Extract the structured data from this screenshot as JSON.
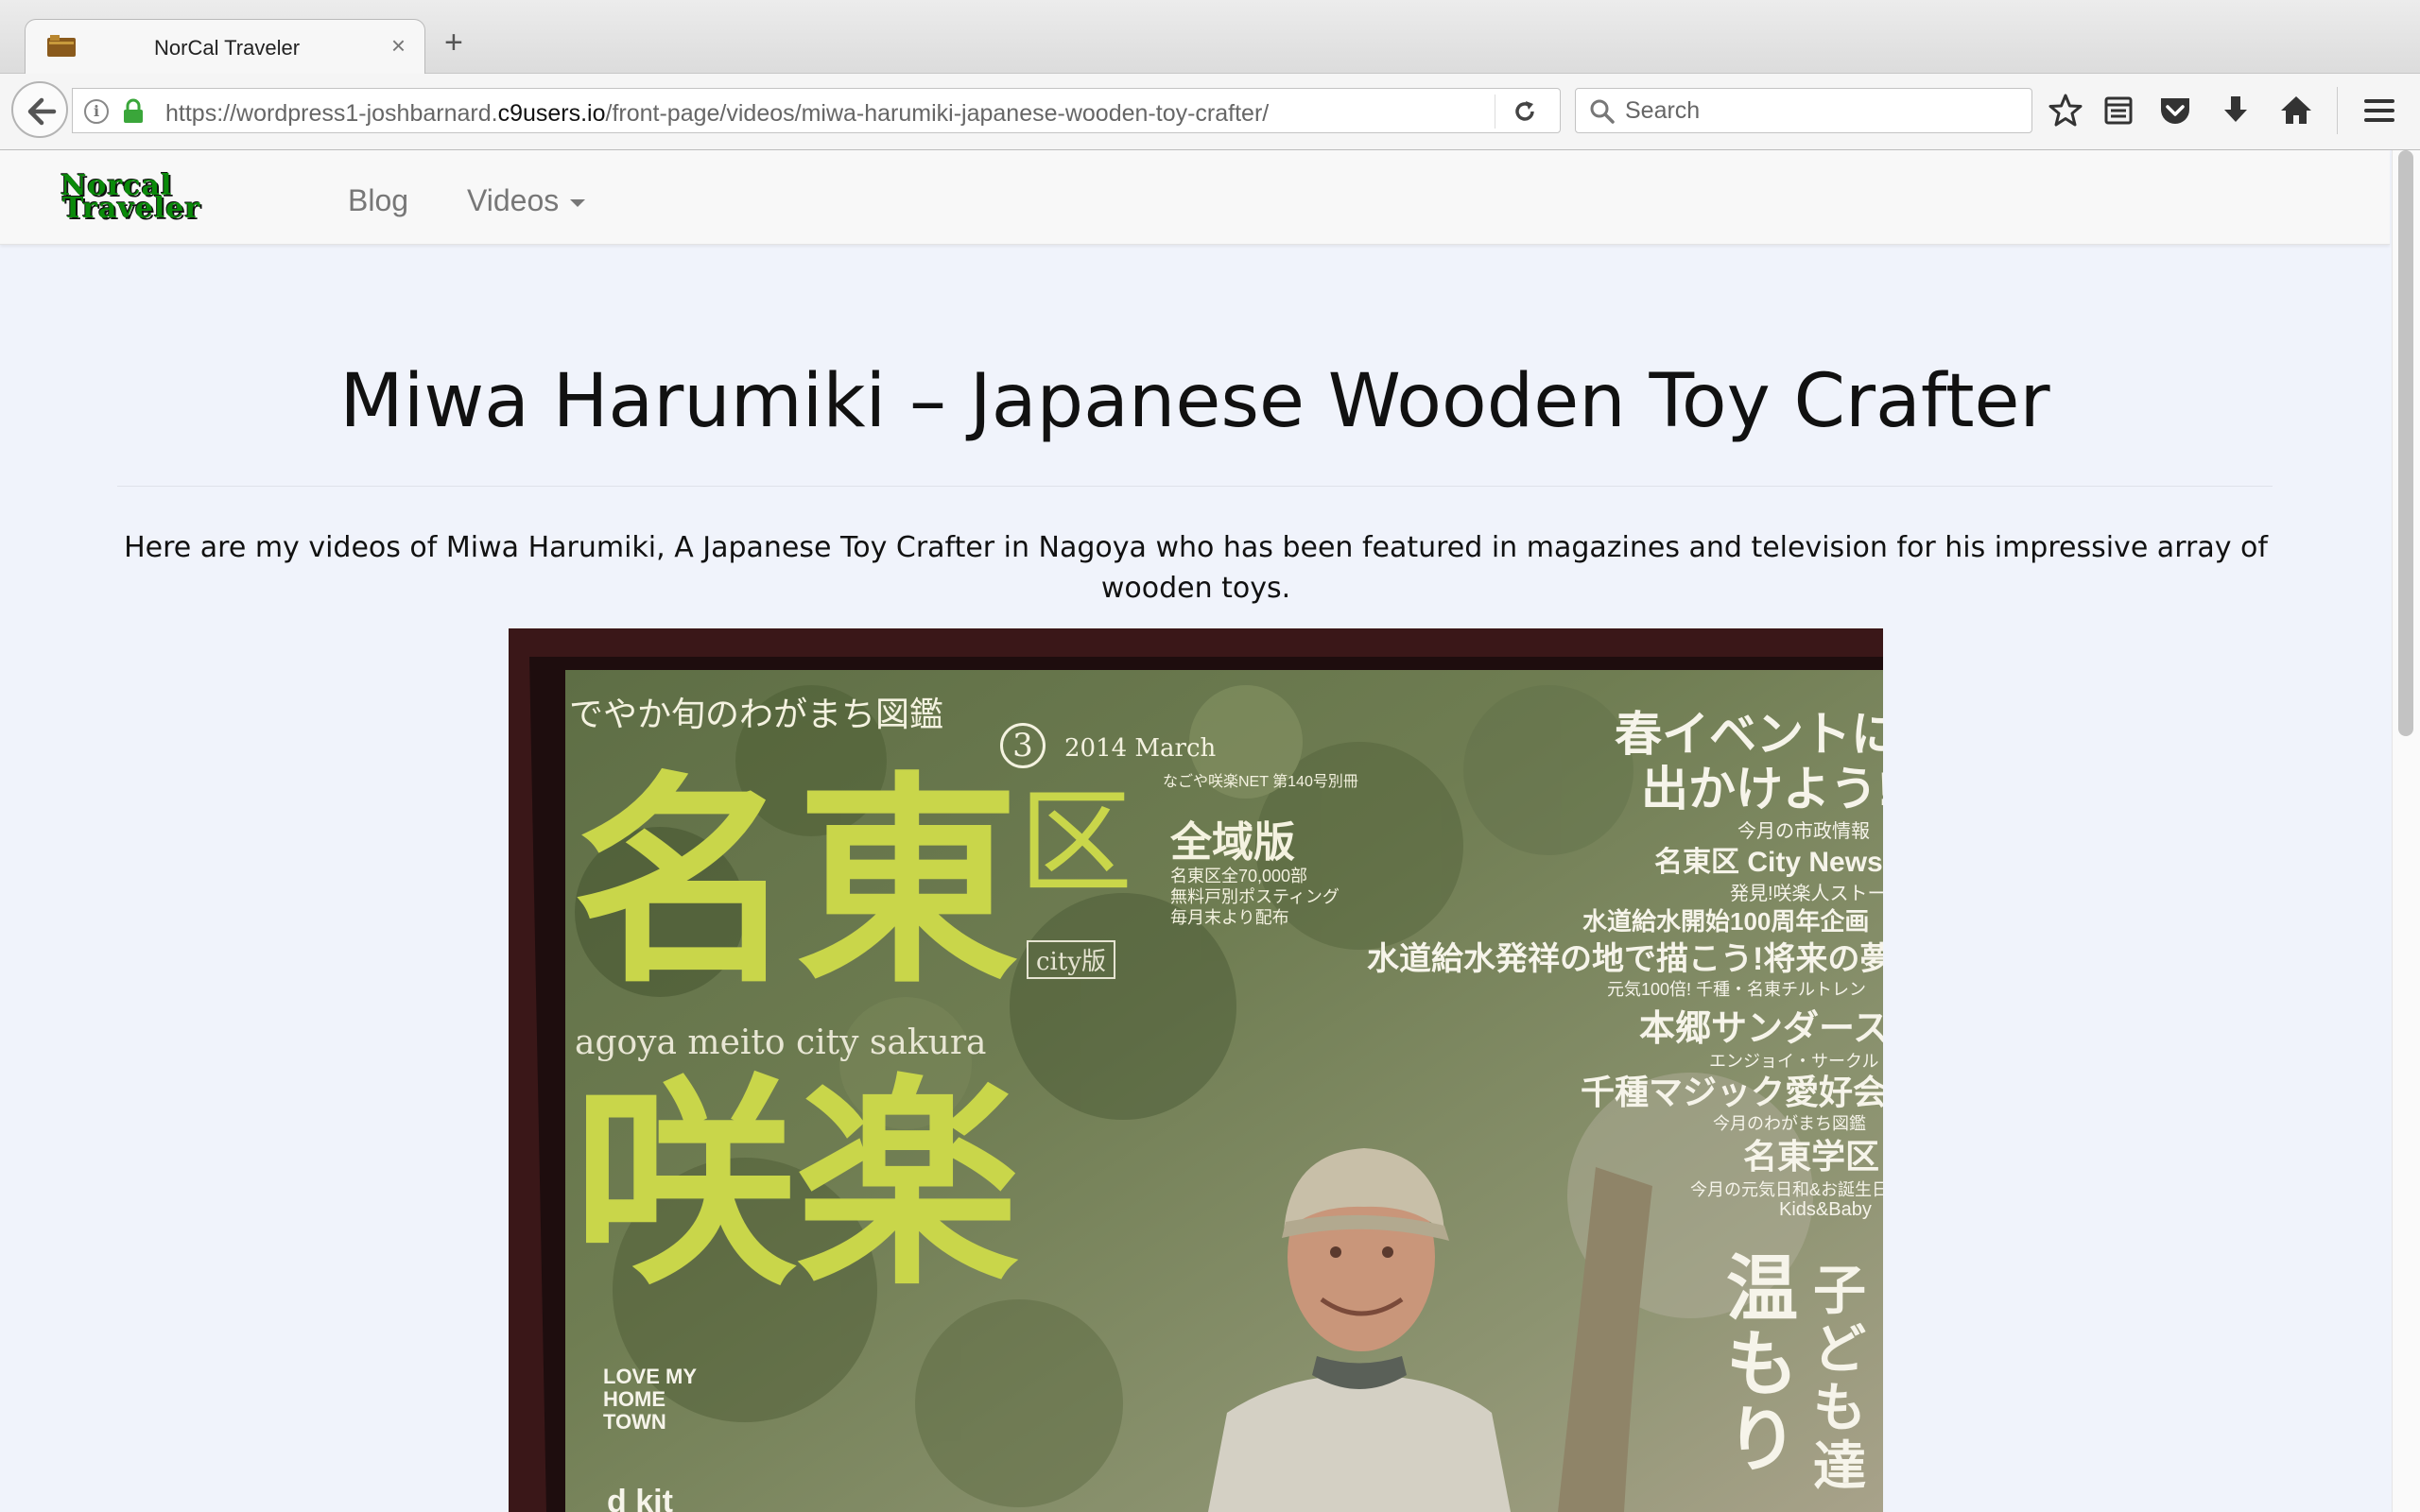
{
  "browser": {
    "tab_title": "NorCal Traveler",
    "tab_close": "×",
    "new_tab": "+",
    "url_prefix": "https://wordpress1-joshbarnard.",
    "url_domain": "c9users.io",
    "url_path": "/front-page/videos/miwa-harumiki-japanese-wooden-toy-crafter/",
    "search_placeholder": "Search"
  },
  "site": {
    "logo_line1": "Norcal",
    "logo_line2": "Traveler",
    "nav": {
      "blog": "Blog",
      "videos": "Videos"
    }
  },
  "content": {
    "title": "Miwa Harumiki – Japanese Wooden Toy Crafter",
    "intro": "Here are my videos of Miwa Harumiki, A Japanese Toy Crafter in Nagoya who has been featured in magazines and television for his impressive array of wooden toys."
  },
  "magazine": {
    "kicker": "でやか旬のわがまち図鑑",
    "issue_num": "3",
    "issue_date": "2014 March",
    "net_line": "なごや咲楽NET 第140号別冊",
    "big1": "名東",
    "ku": "区",
    "city": "city版",
    "edition": "全域版",
    "dist": "名東区全70,000部",
    "free": "無料戸別ポスティング",
    "monthly": "毎月末より配布",
    "romaji": "agoya meito city sakura",
    "big2": "咲楽",
    "h1": "春イベントに",
    "h2": "出かけよう!",
    "tag1": "今月の市政情報",
    "news": "名東区 City News",
    "tag2": "発見!咲楽人ストーリー",
    "water1": "水道給水開始100周年企画",
    "water2": "水道給水発祥の地で描こう!将来の夢",
    "tag3": "元気100倍! 千種・名東チルトレン",
    "hongo": "本郷サンダース",
    "tag4": "エンジョイ・サークル",
    "magic": "千種マジック愛好会",
    "tag5": "今月のわがまち図鑑",
    "school": "名東学区",
    "tag6": "今月の元気日和&お誕生日",
    "kids": "Kids&Baby",
    "v1": "温もり",
    "v2": "子ども達",
    "love": "LOVE MY HOME TOWN",
    "kit": "d kit"
  },
  "colors": {
    "page_bg": "#f0f3fb",
    "logo_green": "#0a8a0a",
    "nav_text": "#777777"
  }
}
